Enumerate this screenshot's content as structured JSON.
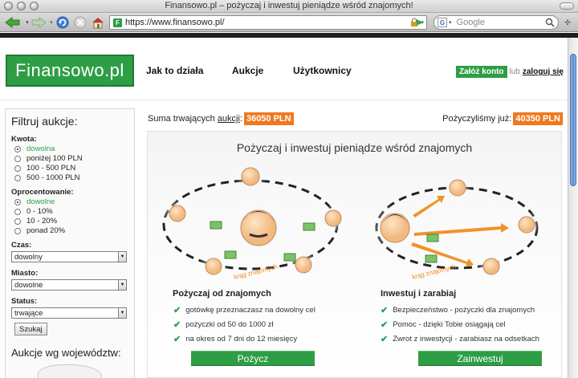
{
  "window": {
    "title": "Finansowo.pl – pożyczaj i inwestuj pieniądze wśród znajomych!"
  },
  "browser": {
    "url": "https://www.finansowo.pl/",
    "search_placeholder": "Google",
    "favicon_letter": "F",
    "search_engine_letter": "G"
  },
  "site": {
    "logo": "Finansowo.pl",
    "nav": [
      "Jak to działa",
      "Aukcje",
      "Użytkownicy"
    ],
    "signup": "Załóż konto",
    "or": "lub",
    "login": "zaloguj się"
  },
  "sidebar": {
    "title": "Filtruj aukcje:",
    "amount_label": "Kwota:",
    "amount_options": [
      "dowolna",
      "poniżej 100 PLN",
      "100 - 500 PLN",
      "500 - 1000 PLN"
    ],
    "amount_selected": 0,
    "interest_label": "Oprocentowanie:",
    "interest_options": [
      "dowolne",
      "0 - 10%",
      "10 - 20%",
      "ponad 20%"
    ],
    "interest_selected": 0,
    "time_label": "Czas:",
    "time_value": "dowolny",
    "city_label": "Miasto:",
    "city_value": "dowolne",
    "status_label": "Status:",
    "status_value": "trwające",
    "search_button": "Szukaj",
    "regions_title": "Aukcje wg województw:"
  },
  "stats": {
    "ongoing_prefix": "Suma trwających",
    "ongoing_link": "aukcji",
    "ongoing_colon": ":",
    "ongoing_amount": "36050 PLN",
    "lent_label": "Pożyczyliśmy już:",
    "lent_amount": "40350 PLN"
  },
  "panel": {
    "title": "Pożyczaj i inwestuj pieniądze wśród znajomych",
    "circle_label": "krąg znajomych",
    "borrow": {
      "title": "Pożyczaj od znajomych",
      "points": [
        "gotówkę przeznaczasz na dowolny cel",
        "pożyczki od 50 do 1000 zł",
        "na okres od 7 dni do 12 miesięcy"
      ],
      "button": "Pożycz"
    },
    "invest": {
      "title": "Inwestuj i zarabiaj",
      "points": [
        "Bezpieczeństwo - pożyczki dla znajomych",
        "Pomoc - dzięki Tobie osiągają cel",
        "Zwrot z inwestycji - zarabiasz na odsetkach"
      ],
      "button": "Zainwestuj"
    }
  },
  "colors": {
    "brand_green": "#2e9e45",
    "accent_orange": "#f07820"
  }
}
